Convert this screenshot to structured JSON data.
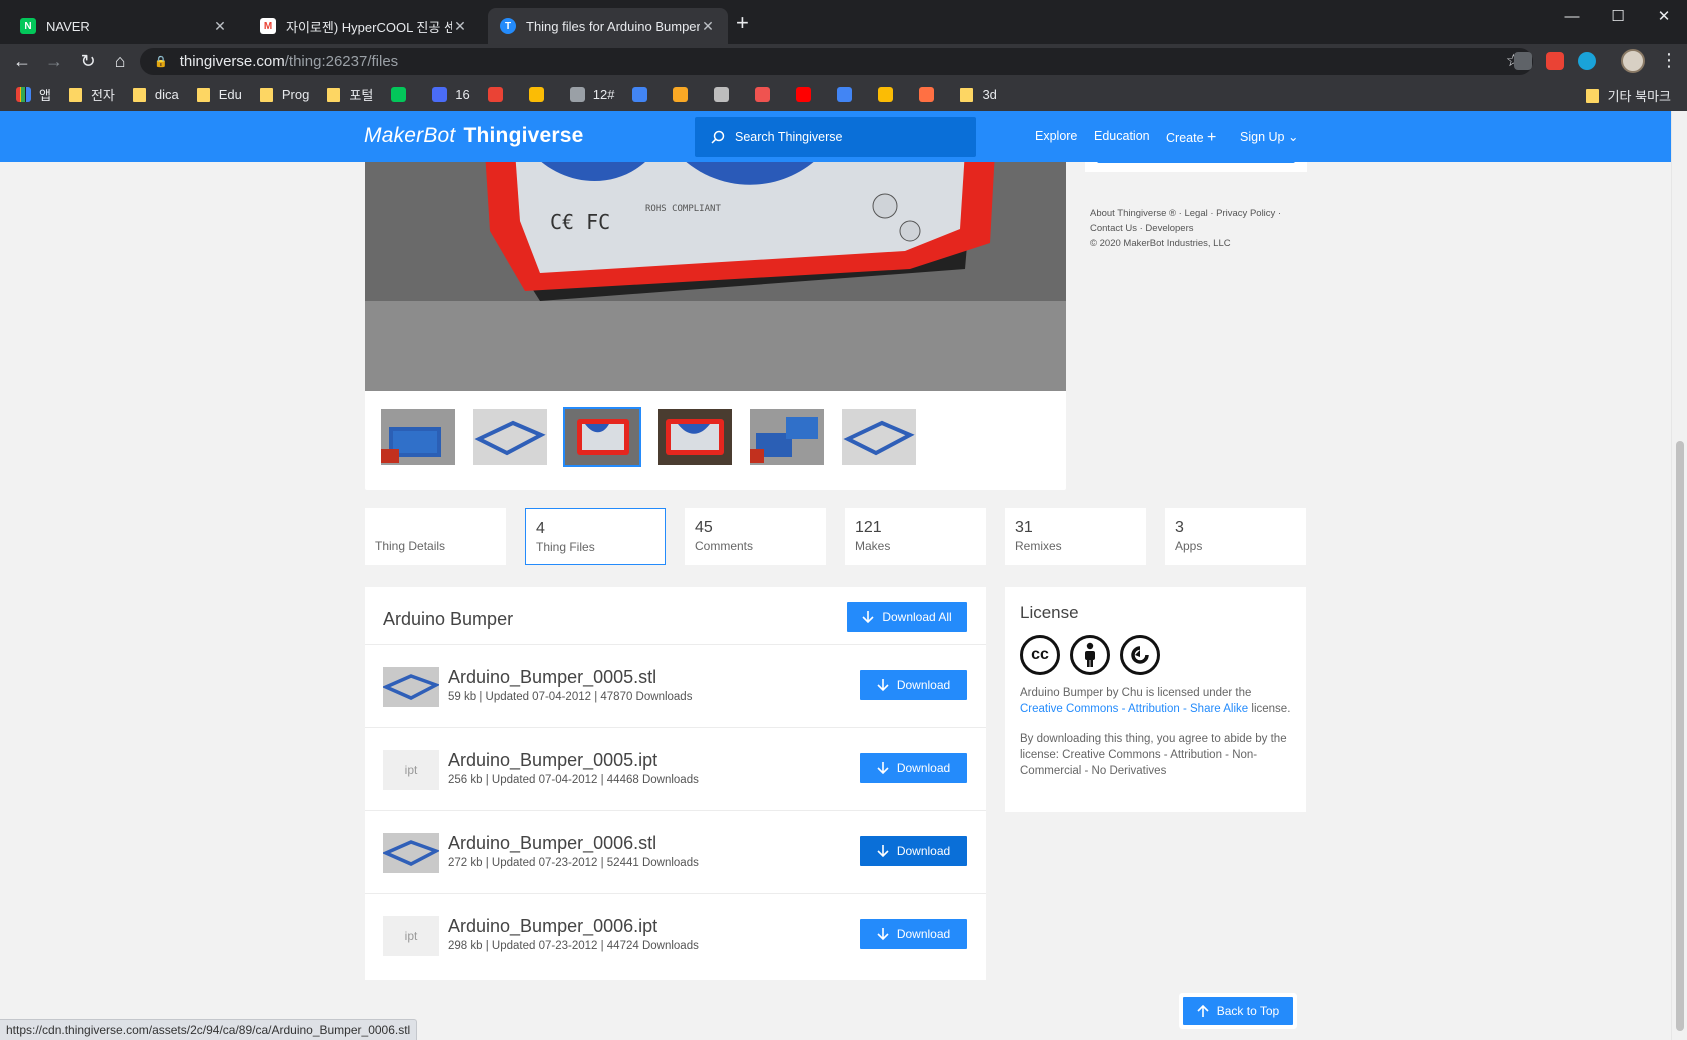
{
  "browser": {
    "tabs": [
      {
        "title": "NAVER",
        "icon": "naver-icon",
        "color": "#03c75a"
      },
      {
        "title": "자이로젠) HyperCOOL 진공 센서",
        "icon": "gmail-icon",
        "color": "#ea4335"
      },
      {
        "title": "Thing files for Arduino Bumper",
        "icon": "thingiverse-icon",
        "color": "#248bfb"
      }
    ],
    "url_host": "thingiverse.com",
    "url_path": "/thing:26237/files",
    "bookmarks": [
      {
        "label": "앱",
        "type": "apps"
      },
      {
        "label": "전자",
        "type": "folder"
      },
      {
        "label": "dica",
        "type": "folder"
      },
      {
        "label": "Edu",
        "type": "folder"
      },
      {
        "label": "Prog",
        "type": "folder"
      },
      {
        "label": "포털",
        "type": "folder"
      },
      {
        "label": "",
        "type": "icon",
        "color": "#03c75a"
      },
      {
        "label": "16",
        "type": "icon",
        "color": "#4a6cf7"
      },
      {
        "label": "",
        "type": "icon",
        "color": "#ea4335"
      },
      {
        "label": "",
        "type": "icon",
        "color": "#fbbc05"
      },
      {
        "label": "12#",
        "type": "icon",
        "color": "#9aa0a6"
      },
      {
        "label": "",
        "type": "icon",
        "color": "#4285f4"
      },
      {
        "label": "",
        "type": "icon",
        "color": "#f9a825"
      },
      {
        "label": "",
        "type": "icon",
        "color": "#bdbdbd"
      },
      {
        "label": "",
        "type": "icon",
        "color": "#ef5350"
      },
      {
        "label": "",
        "type": "icon",
        "color": "#ff0000"
      },
      {
        "label": "",
        "type": "icon",
        "color": "#4285f4"
      },
      {
        "label": "",
        "type": "icon",
        "color": "#fbbc05"
      },
      {
        "label": "",
        "type": "icon",
        "color": "#ff7043"
      },
      {
        "label": "3d",
        "type": "folder"
      }
    ],
    "other_bookmarks": "기타 북마크",
    "status_url": "https://cdn.thingiverse.com/assets/2c/94/ca/89/ca/Arduino_Bumper_0006.stl"
  },
  "site": {
    "logo_brand": "MakerBot",
    "logo_product": "Thingiverse",
    "search_placeholder": "Search Thingiverse",
    "nav": {
      "explore": "Explore",
      "education": "Education",
      "create": "Create",
      "signup": "Sign Up"
    },
    "accent_color": "#248bfb"
  },
  "sidebar": {
    "footer_line1": "About Thingiverse ® · Legal · Privacy Policy ·",
    "footer_line2": "Contact Us · Developers",
    "footer_line3": "© 2020 MakerBot Industries, LLC"
  },
  "tabs": [
    {
      "count": "",
      "label": "Thing Details"
    },
    {
      "count": "4",
      "label": "Thing Files"
    },
    {
      "count": "45",
      "label": "Comments"
    },
    {
      "count": "121",
      "label": "Makes"
    },
    {
      "count": "31",
      "label": "Remixes"
    },
    {
      "count": "3",
      "label": "Apps"
    }
  ],
  "files": {
    "title": "Arduino Bumper",
    "download_all": "Download All",
    "download_label": "Download",
    "items": [
      {
        "name": "Arduino_Bumper_0005.stl",
        "meta": "59 kb | Updated 07-04-2012 | 47870 Downloads",
        "thumb": "stl"
      },
      {
        "name": "Arduino_Bumper_0005.ipt",
        "meta": "256 kb | Updated 07-04-2012 | 44468 Downloads",
        "thumb": "ipt"
      },
      {
        "name": "Arduino_Bumper_0006.stl",
        "meta": "272 kb | Updated 07-23-2012 | 52441 Downloads",
        "thumb": "stl"
      },
      {
        "name": "Arduino_Bumper_0006.ipt",
        "meta": "298 kb | Updated 07-23-2012 | 44724 Downloads",
        "thumb": "ipt"
      }
    ]
  },
  "license": {
    "title": "License",
    "text_before": "Arduino Bumper by Chu is licensed under the",
    "link": "Creative Commons - Attribution - Share Alike",
    "text_after": "license.",
    "agree": "By downloading this thing, you agree to abide by the license: Creative Commons - Attribution - Non-Commercial - No Derivatives"
  },
  "back_to_top": "Back to Top"
}
